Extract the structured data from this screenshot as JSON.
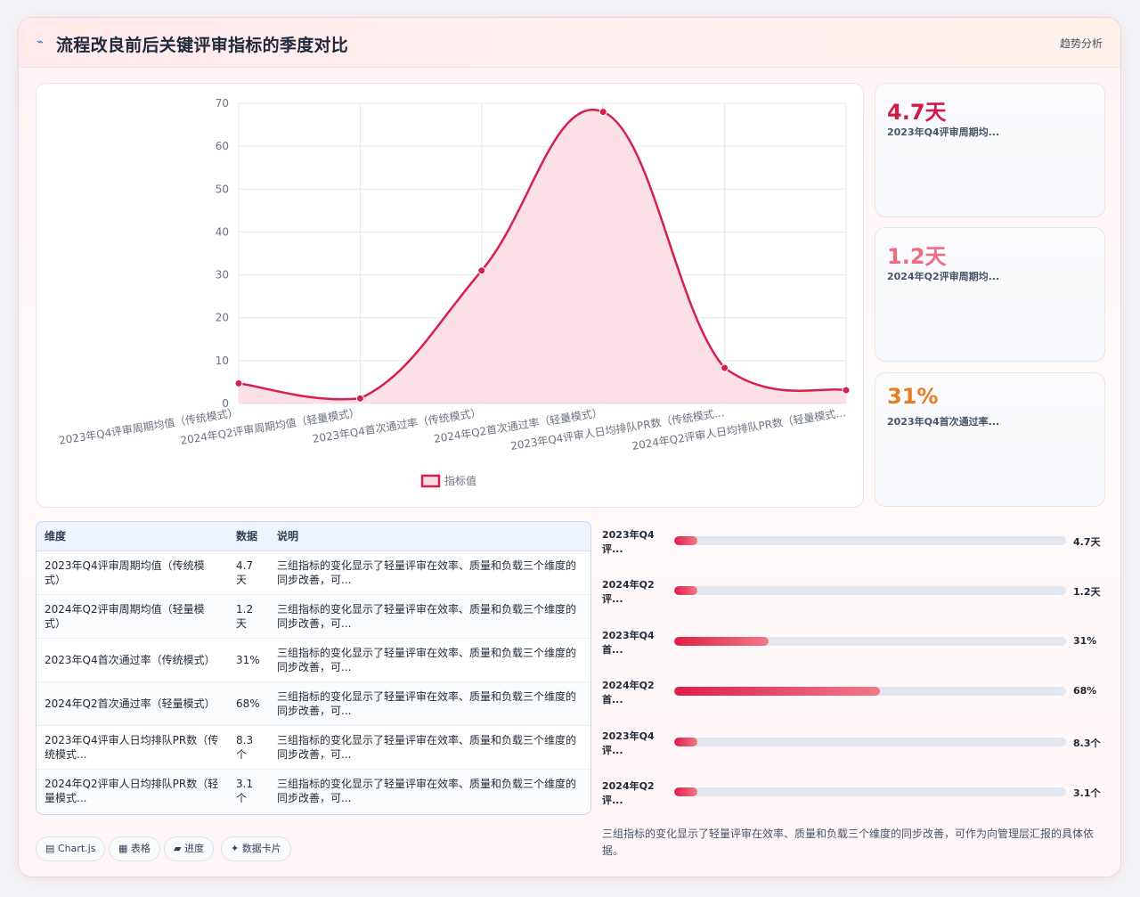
{
  "header": {
    "icon": "⌁",
    "title": "流程改良前后关键评审指标的季度对比",
    "action": "趋势分析"
  },
  "chart_data": {
    "type": "line",
    "categories": [
      "2023年Q4评审周期均值（传统模式）",
      "2024年Q2评审周期均值（轻量模式）",
      "2023年Q4首次通过率（传统模式）",
      "2024年Q2首次通过率（轻量模式）",
      "2023年Q4评审人日均排队PR数（传统模式...",
      "2024年Q2评审人日均排队PR数（轻量模式..."
    ],
    "series": [
      {
        "name": "指标值",
        "values": [
          4.7,
          1.2,
          31,
          68,
          8.3,
          3.1
        ]
      }
    ],
    "ylim": [
      0,
      70
    ],
    "yticks": [
      "0",
      "10",
      "20",
      "30",
      "40",
      "50",
      "60",
      "70"
    ],
    "grid": true,
    "legend": "bottom",
    "color": "#d6204c",
    "fill": "#fbdbe3"
  },
  "stats": [
    {
      "value": "4.7天",
      "label": "2023年Q4评审周期均...",
      "color": "#d11a45"
    },
    {
      "value": "1.2天",
      "label": "2024年Q2评审周期均...",
      "color": "#ef6a83"
    },
    {
      "value": "31%",
      "label": "2023年Q4首次通过率...",
      "color": "#e67e22"
    }
  ],
  "table": {
    "headers": [
      "维度",
      "数据",
      "说明"
    ],
    "rows": [
      [
        "2023年Q4评审周期均值（传统模式）",
        "4.7天",
        "三组指标的变化显示了轻量评审在效率、质量和负载三个维度的同步改善，可..."
      ],
      [
        "2024年Q2评审周期均值（轻量模式）",
        "1.2天",
        "三组指标的变化显示了轻量评审在效率、质量和负载三个维度的同步改善，可..."
      ],
      [
        "2023年Q4首次通过率（传统模式）",
        "31%",
        "三组指标的变化显示了轻量评审在效率、质量和负载三个维度的同步改善，可..."
      ],
      [
        "2024年Q2首次通过率（轻量模式）",
        "68%",
        "三组指标的变化显示了轻量评审在效率、质量和负载三个维度的同步改善，可..."
      ],
      [
        "2023年Q4评审人日均排队PR数（传统模式...",
        "8.3个",
        "三组指标的变化显示了轻量评审在效率、质量和负载三个维度的同步改善，可..."
      ],
      [
        "2024年Q2评审人日均排队PR数（轻量模式...",
        "3.1个",
        "三组指标的变化显示了轻量评审在效率、质量和负载三个维度的同步改善，可..."
      ]
    ]
  },
  "progress": [
    {
      "label": "2023年Q4评...",
      "value": "4.7天",
      "fraction": 0.06
    },
    {
      "label": "2024年Q2评...",
      "value": "1.2天",
      "fraction": 0.06
    },
    {
      "label": "2023年Q4首...",
      "value": "31%",
      "fraction": 0.24
    },
    {
      "label": "2024年Q2首...",
      "value": "68%",
      "fraction": 0.525
    },
    {
      "label": "2023年Q4评...",
      "value": "8.3个",
      "fraction": 0.06
    },
    {
      "label": "2024年Q2评...",
      "value": "3.1个",
      "fraction": 0.06
    }
  ],
  "note": "三组指标的变化显示了轻量评审在效率、质量和负载三个维度的同步改善，可作为向管理层汇报的具体依据。",
  "chips": [
    {
      "icon": "▤",
      "label": "Chart.js"
    },
    {
      "icon": "▦",
      "label": "表格"
    },
    {
      "icon": "▰",
      "label": "进度"
    },
    {
      "icon": "✦",
      "label": "数据卡片"
    }
  ]
}
